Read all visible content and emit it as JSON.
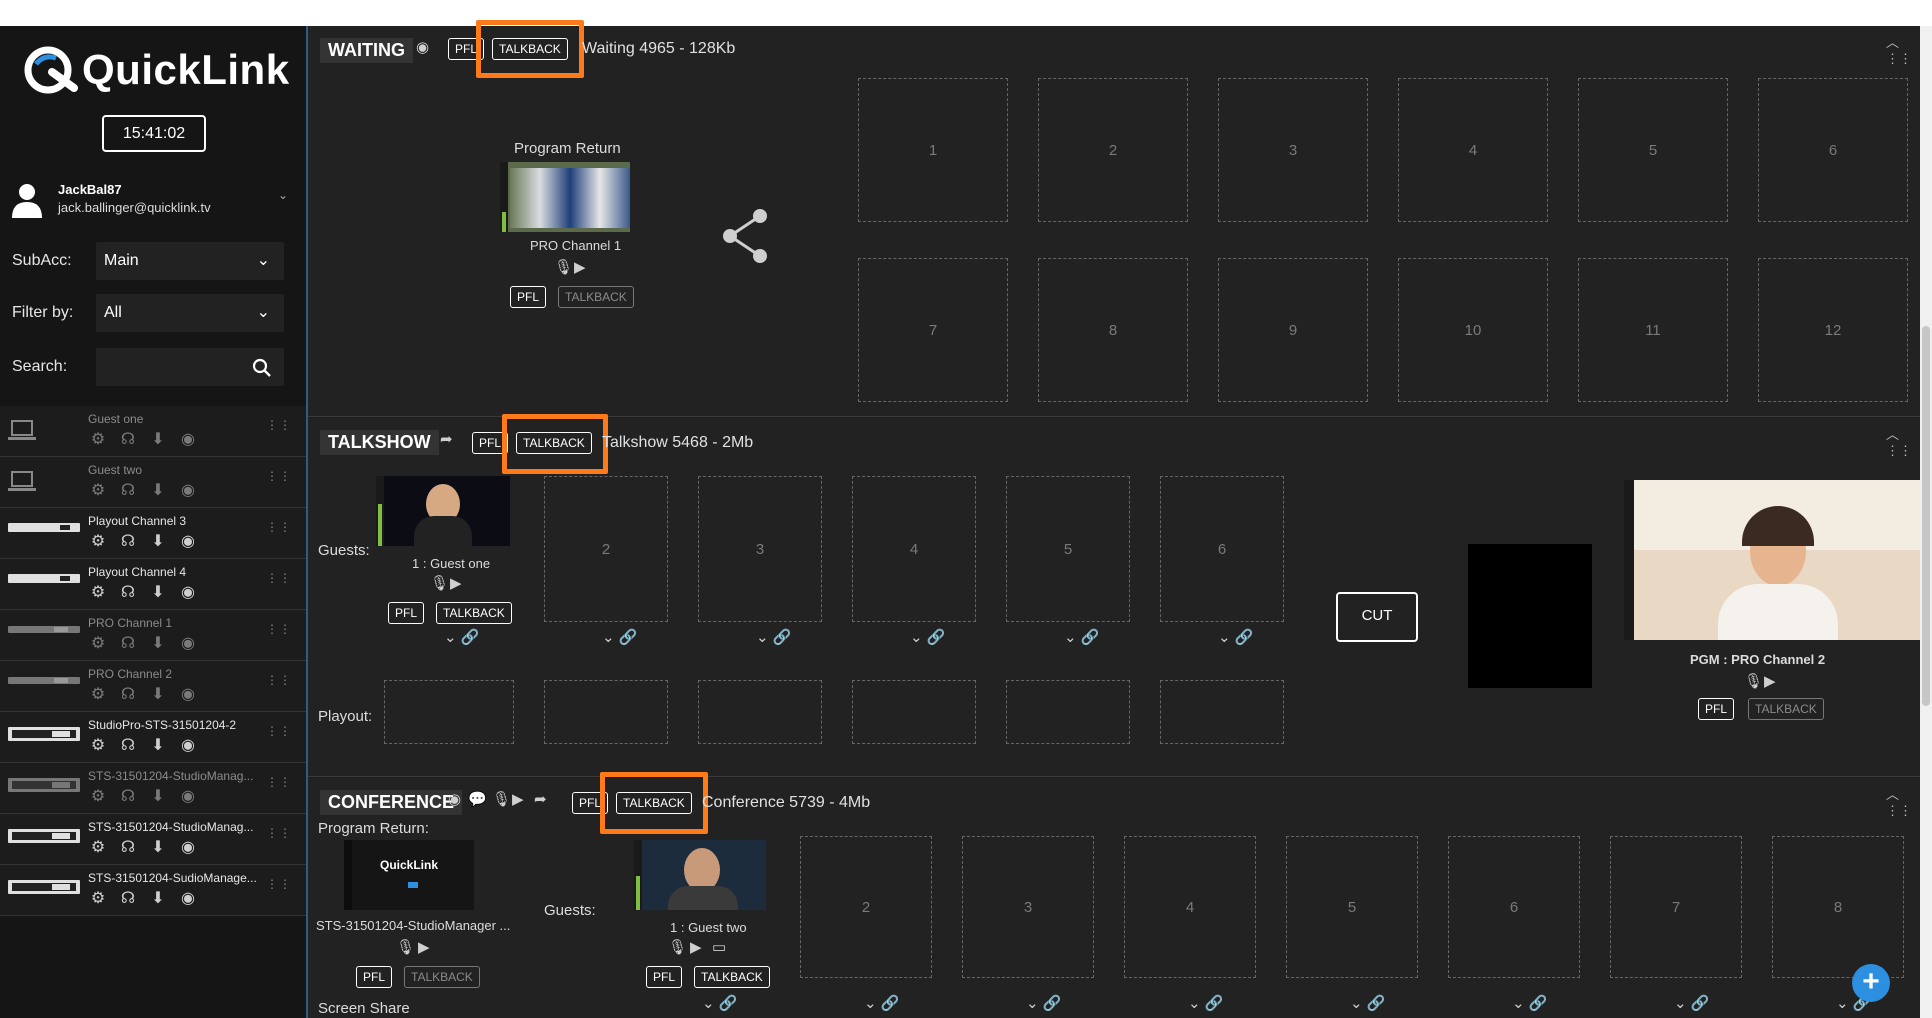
{
  "app": {
    "brand": "QuickLink",
    "clock": "15:41:02"
  },
  "user": {
    "name": "JackBal87",
    "email": "jack.ballinger@quicklink.tv"
  },
  "filters": {
    "subacc_label": "SubAcc:",
    "subacc_value": "Main",
    "filter_label": "Filter by:",
    "filter_value": "All",
    "search_label": "Search:"
  },
  "devices": [
    {
      "name": "Guest one",
      "dim": true
    },
    {
      "name": "Guest two",
      "dim": true
    },
    {
      "name": "Playout Channel 3",
      "dim": false
    },
    {
      "name": "Playout Channel 4",
      "dim": false
    },
    {
      "name": "PRO Channel 1",
      "dim": true
    },
    {
      "name": "PRO Channel 2",
      "dim": true
    },
    {
      "name": "StudioPro-STS-31501204-2",
      "dim": false
    },
    {
      "name": "STS-31501204-StudioManag...",
      "dim": true
    },
    {
      "name": "STS-31501204-StudioManag...",
      "dim": false
    },
    {
      "name": "STS-31501204-SudioManage...",
      "dim": false
    }
  ],
  "common": {
    "pfl": "PFL",
    "talkback": "TALKBACK",
    "cut": "CUT"
  },
  "waiting": {
    "title": "WAITING",
    "info": "Waiting 4965 - 128Kb",
    "program_return_label": "Program Return",
    "channel": "PRO Channel 1",
    "slots": [
      "1",
      "2",
      "3",
      "4",
      "5",
      "6",
      "7",
      "8",
      "9",
      "10",
      "11",
      "12"
    ]
  },
  "talkshow": {
    "title": "TALKSHOW",
    "info": "Talkshow 5468 - 2Mb",
    "guests_label": "Guests:",
    "playout_label": "Playout:",
    "guest1": "1 : Guest one",
    "slots": [
      "2",
      "3",
      "4",
      "5",
      "6"
    ],
    "pgm": "PGM : PRO Channel 2"
  },
  "conference": {
    "title": "CONFERENCE",
    "info": "Conference 5739 - 4Mb",
    "program_return_label": "Program Return:",
    "pr_logo": "QuickLink",
    "pr_name": "STS-31501204-StudioManager ...",
    "guests_label": "Guests:",
    "guest1": "1 : Guest two",
    "slots": [
      "2",
      "3",
      "4",
      "5",
      "6",
      "7",
      "8"
    ],
    "screen_share": "Screen Share"
  },
  "colors": {
    "highlight": "#ff7a1a",
    "accent_blue": "#2d8fe0"
  }
}
